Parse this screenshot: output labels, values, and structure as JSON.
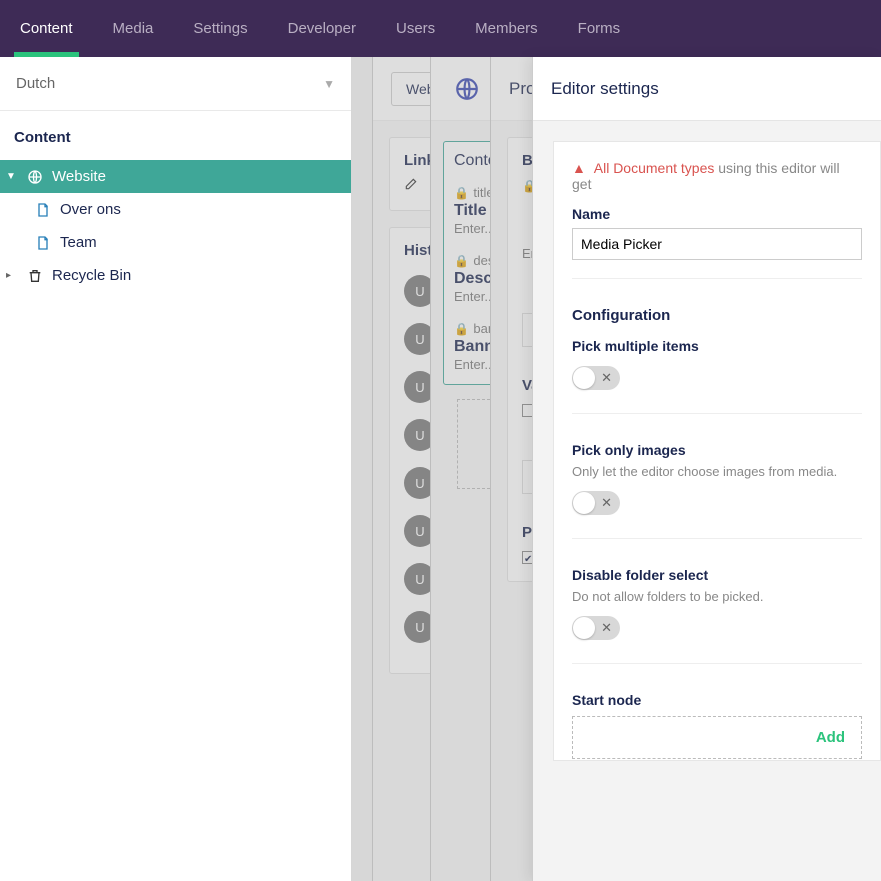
{
  "topnav": {
    "items": [
      {
        "label": "Content",
        "active": true
      },
      {
        "label": "Media"
      },
      {
        "label": "Settings"
      },
      {
        "label": "Developer"
      },
      {
        "label": "Users"
      },
      {
        "label": "Members"
      },
      {
        "label": "Forms"
      }
    ]
  },
  "sidebar": {
    "language": "Dutch",
    "header": "Content",
    "tree": {
      "website": "Website",
      "over_ons": "Over ons",
      "team": "Team",
      "recycle": "Recycle Bin"
    }
  },
  "layer1": {
    "header_btn": "Website",
    "card_links": "Links",
    "card_history": "History",
    "u": "U"
  },
  "layer2": {
    "tab": "Content",
    "p_title_alias": "title",
    "p_title": "Title",
    "p_desc_alias": "description",
    "p_desc": "Description",
    "p_ban_alias": "banner",
    "p_ban": "Banner",
    "enter": "Enter..."
  },
  "layer3": {
    "tab": "Properties",
    "banner": "Banner",
    "enter": "Enter",
    "validation": "Validation",
    "properties": "Properties"
  },
  "editor": {
    "title": "Editor settings",
    "warn_red": "All Document types",
    "warn_rest": "using this editor will get",
    "name_label": "Name",
    "name_value": "Media Picker",
    "configuration": "Configuration",
    "pick_multiple": "Pick multiple items",
    "pick_images": "Pick only images",
    "pick_images_sub": "Only let the editor choose images from media.",
    "disable_folder": "Disable folder select",
    "disable_folder_sub": "Do not allow folders to be picked.",
    "start_node": "Start node",
    "add": "Add"
  }
}
